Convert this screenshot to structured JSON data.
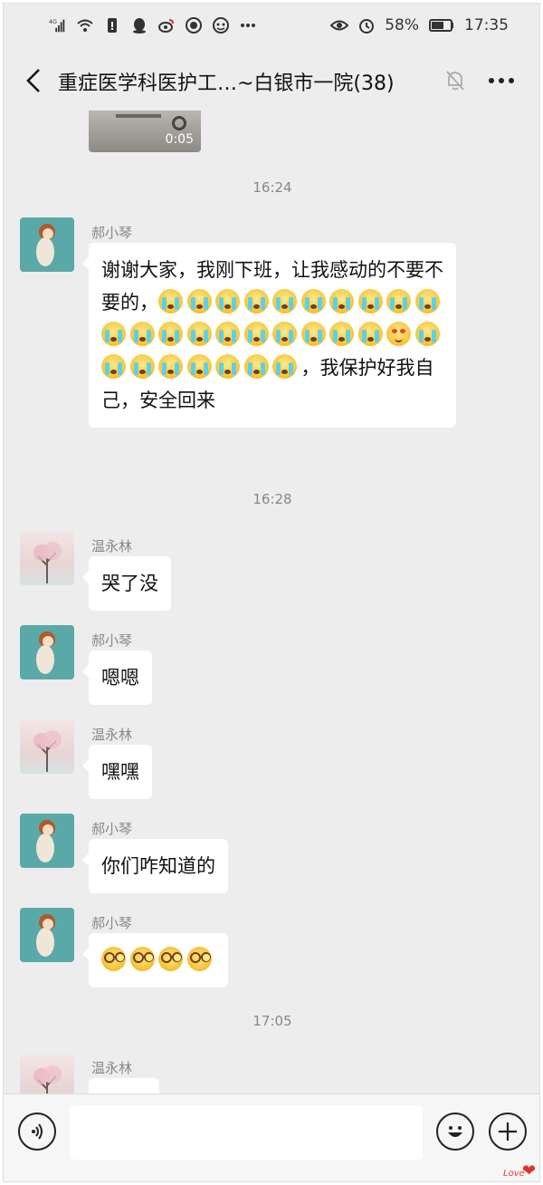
{
  "status_bar": {
    "network": "4G",
    "battery": "58%",
    "time": "17:35"
  },
  "header": {
    "title": "重症医学科医护工…~白银市一院(38)",
    "more_label": "···"
  },
  "video": {
    "duration": "0:05"
  },
  "messages": [
    {
      "type": "time",
      "text": "16:24"
    },
    {
      "type": "msg",
      "sender": "郝小琴",
      "avatar": "hao",
      "text_before": "谢谢大家，我刚下班，让我感动的不要不要的，",
      "emoji_count": 29,
      "text_after": "，我保护好我自己，安全回来"
    },
    {
      "type": "time",
      "text": "16:28"
    },
    {
      "type": "msg",
      "sender": "温永林",
      "avatar": "wen",
      "text": "哭了没"
    },
    {
      "type": "msg",
      "sender": "郝小琴",
      "avatar": "hao",
      "text": "嗯嗯"
    },
    {
      "type": "msg",
      "sender": "温永林",
      "avatar": "wen",
      "text": "嘿嘿"
    },
    {
      "type": "msg",
      "sender": "郝小琴",
      "avatar": "hao",
      "text": "你们咋知道的"
    },
    {
      "type": "msg",
      "sender": "郝小琴",
      "avatar": "hao",
      "emoji": "dizzy",
      "emoji_count": 4
    },
    {
      "type": "time",
      "text": "17:05"
    },
    {
      "type": "msg",
      "sender": "温永林",
      "avatar": "wen",
      "text": ""
    }
  ],
  "input": {
    "value": ""
  },
  "watermark": "Love",
  "icons": {
    "back": "chevron-left-icon",
    "mute": "bell-off-icon",
    "more": "more-horizontal-icon",
    "voice": "voice-icon",
    "emoji": "smiley-icon",
    "plus": "plus-icon"
  }
}
